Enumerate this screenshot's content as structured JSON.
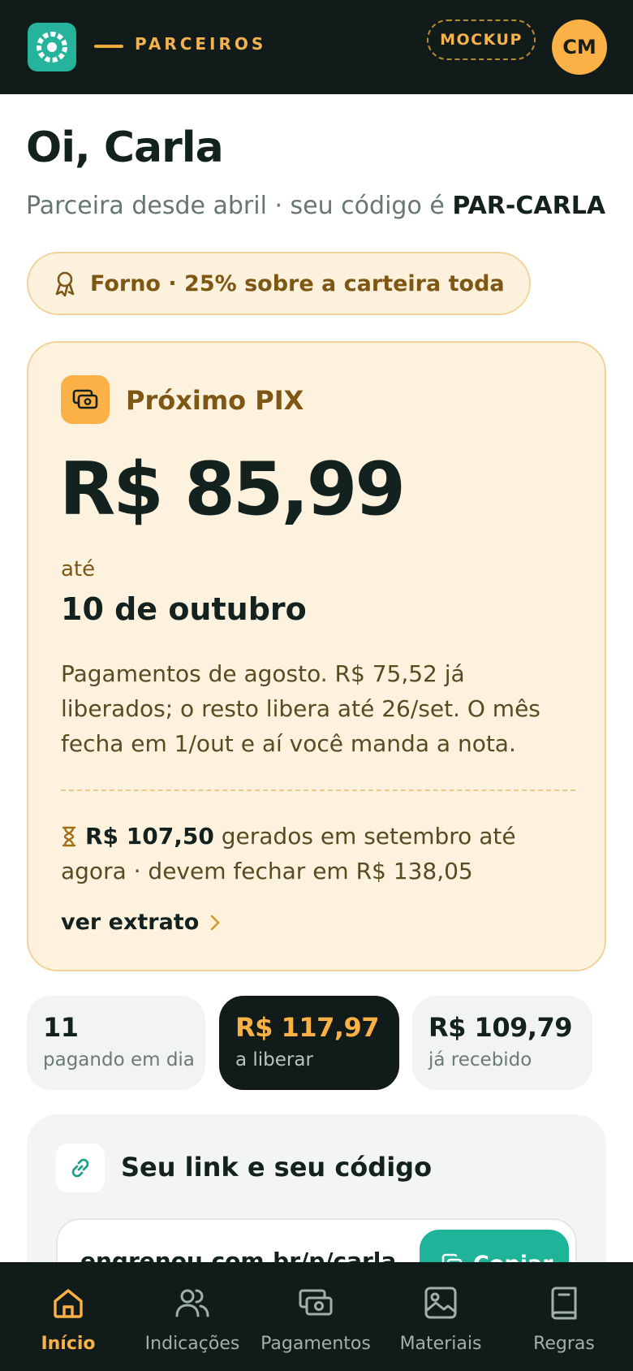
{
  "header": {
    "brand": "PARCEIROS",
    "mockup_badge": "MOCKUP",
    "avatar_initials": "CM",
    "colors": {
      "bar": "#111b1a",
      "logo": "#25b39b",
      "accent": "#f2b24f",
      "avatar": "#fbb145"
    }
  },
  "greeting": {
    "title": "Oi, Carla",
    "subtitle_prefix": "Parceira desde abril · seu código é",
    "code": "PAR-CARLA"
  },
  "tier": {
    "icon": "award-ribbon-icon",
    "label": "Forno · 25% sobre a carteira toda"
  },
  "next_pix": {
    "icon": "money-icon",
    "title": "Próximo PIX",
    "amount": "R$ 85,99",
    "until_label": "até",
    "date": "10 de outubro",
    "description": "Pagamentos de agosto. R$ 75,52 já liberados; o resto libera até 26/set. O mês fecha em 1/out e aí você manda a nota.",
    "generated_amount": "R$ 107,50",
    "generated_text": "gerados em setembro até agora · devem fechar em R$ 138,05",
    "statement_link": "ver extrato",
    "colors": {
      "background": "#fcf2de",
      "border": "#efd39a",
      "title": "#7f5714"
    }
  },
  "stats": [
    {
      "value": "11",
      "label": "pagando em dia",
      "style": "light"
    },
    {
      "value": "R$ 117,97",
      "label": "a liberar",
      "style": "dark"
    },
    {
      "value": "R$ 109,79",
      "label": "já recebido",
      "style": "light"
    }
  ],
  "link_section": {
    "icon": "link-icon",
    "title": "Seu link e seu código",
    "url": "engrenou.com.br/p/carla",
    "copy_label": "Copiar"
  },
  "bottom_nav": {
    "items": [
      {
        "label": "Início",
        "icon": "home-icon",
        "active": true
      },
      {
        "label": "Indicações",
        "icon": "users-icon",
        "active": false
      },
      {
        "label": "Pagamentos",
        "icon": "money-icon",
        "active": false
      },
      {
        "label": "Materiais",
        "icon": "image-icon",
        "active": false
      },
      {
        "label": "Regras",
        "icon": "book-icon",
        "active": false
      }
    ]
  }
}
